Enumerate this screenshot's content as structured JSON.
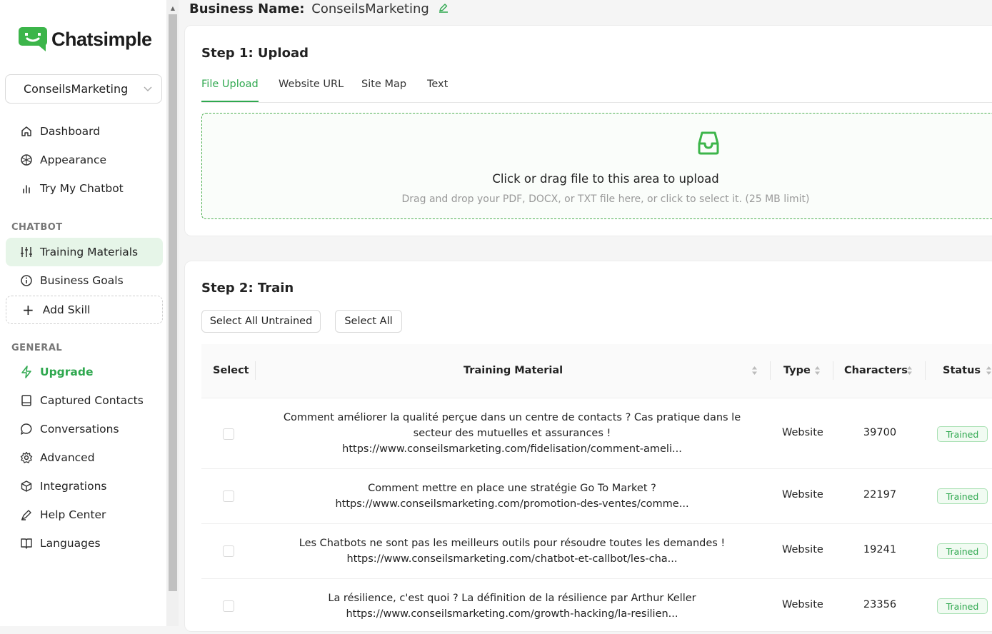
{
  "brand": {
    "name": "Chatsimple",
    "color": "#2fa84f"
  },
  "business_selector": {
    "value": "ConseilsMarketing"
  },
  "nav_main": [
    {
      "label": "Dashboard",
      "icon": "home-icon"
    },
    {
      "label": "Appearance",
      "icon": "palette-icon"
    },
    {
      "label": "Try My Chatbot",
      "icon": "bar-chart-icon"
    }
  ],
  "section_chatbot": "CHATBOT",
  "nav_chatbot": [
    {
      "label": "Training Materials",
      "icon": "sliders-icon",
      "active": true
    },
    {
      "label": "Business Goals",
      "icon": "info-icon"
    }
  ],
  "add_skill_label": "Add Skill",
  "section_general": "GENERAL",
  "nav_general": [
    {
      "label": "Upgrade",
      "icon": "bolt-icon",
      "highlight": true
    },
    {
      "label": "Captured Contacts",
      "icon": "contacts-book-icon"
    },
    {
      "label": "Conversations",
      "icon": "chat-bubble-icon"
    },
    {
      "label": "Advanced",
      "icon": "gear-icon"
    },
    {
      "label": "Integrations",
      "icon": "cube-icon"
    },
    {
      "label": "Help Center",
      "icon": "pen-icon"
    },
    {
      "label": "Languages",
      "icon": "book-open-icon"
    }
  ],
  "header": {
    "label": "Business Name:",
    "value": "ConseilsMarketing"
  },
  "step1": {
    "title": "Step 1: Upload",
    "tabs": [
      "File Upload",
      "Website URL",
      "Site Map",
      "Text"
    ],
    "active_tab": "File Upload",
    "dropzone_title": "Click or drag file to this area to upload",
    "dropzone_hint": "Drag and drop your PDF, DOCX, or TXT file here, or click to select it. (25 MB limit)"
  },
  "step2": {
    "title": "Step 2: Train",
    "buttons": {
      "select_untrained": "Select All Untrained",
      "select_all": "Select All"
    },
    "columns": {
      "select": "Select",
      "material": "Training Material",
      "type": "Type",
      "characters": "Characters",
      "status": "Status"
    },
    "rows": [
      {
        "title": "Comment améliorer la qualité perçue dans un centre de contacts ? Cas pratique dans le secteur des mutuelles et assurances !",
        "url": "https://www.conseilsmarketing.com/fidelisation/comment-ameli...",
        "type": "Website",
        "characters": "39700",
        "status": "Trained"
      },
      {
        "title": "Comment mettre en place une stratégie Go To Market ?",
        "url": "https://www.conseilsmarketing.com/promotion-des-ventes/comme...",
        "type": "Website",
        "characters": "22197",
        "status": "Trained"
      },
      {
        "title": "Les Chatbots ne sont pas les meilleurs outils pour résoudre toutes les demandes !",
        "url": "https://www.conseilsmarketing.com/chatbot-et-callbot/les-cha...",
        "type": "Website",
        "characters": "19241",
        "status": "Trained"
      },
      {
        "title": "La résilience, c'est quoi ? La définition de la résilience par Arthur Keller",
        "url": "https://www.conseilsmarketing.com/growth-hacking/la-resilien...",
        "type": "Website",
        "characters": "23356",
        "status": "Trained"
      }
    ]
  }
}
